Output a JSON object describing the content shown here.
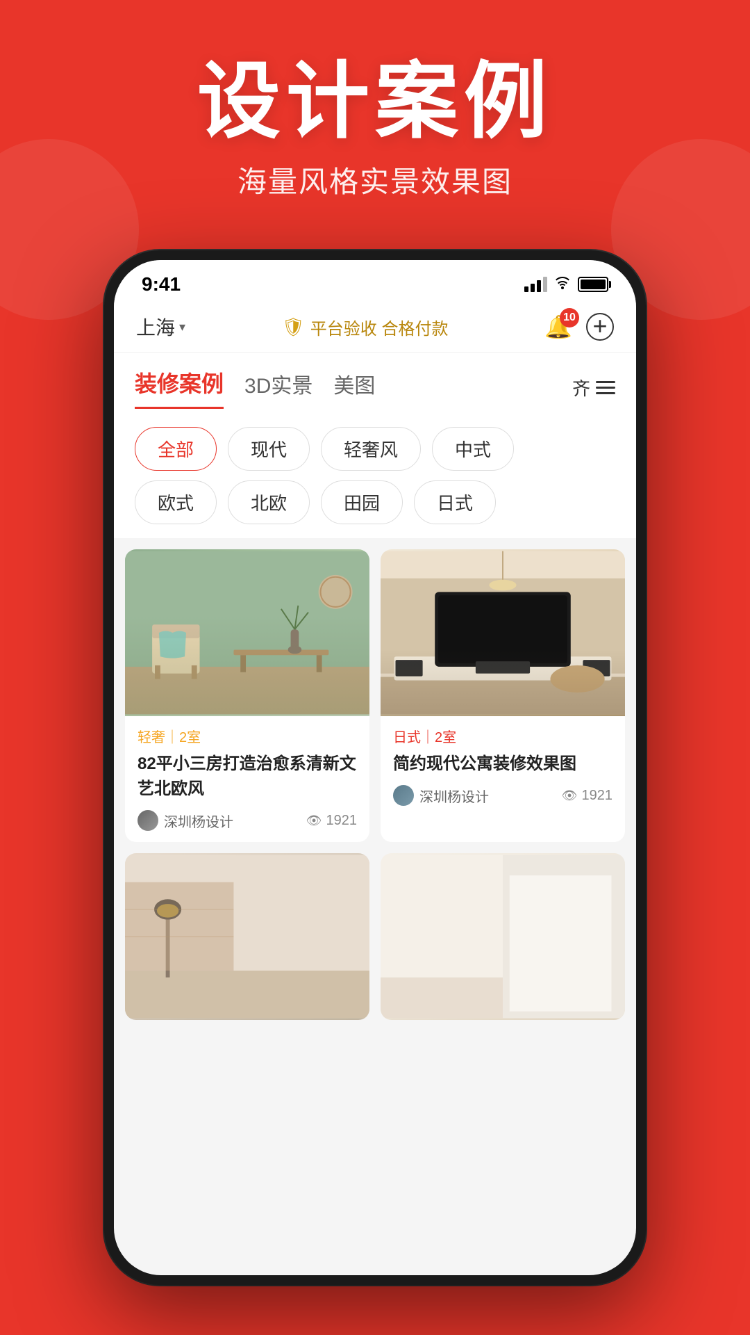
{
  "background": {
    "color": "#e8352a"
  },
  "hero": {
    "title": "设计案例",
    "subtitle": "海量风格实景效果图"
  },
  "statusBar": {
    "time": "9:41",
    "signal": "signal",
    "wifi": "wifi",
    "battery": "battery"
  },
  "topNav": {
    "city": "上海",
    "platform_text": "平台验收 合格付款",
    "notification_count": "10",
    "city_label": "上海 >"
  },
  "tabs": [
    {
      "id": "renovation",
      "label": "装修案例",
      "active": true
    },
    {
      "id": "3d",
      "label": "3D实景",
      "active": false
    },
    {
      "id": "beauty",
      "label": "美图",
      "active": false
    }
  ],
  "filters": {
    "row1": [
      {
        "id": "all",
        "label": "全部",
        "active": true
      },
      {
        "id": "modern",
        "label": "现代",
        "active": false
      },
      {
        "id": "luxury",
        "label": "轻奢风",
        "active": false
      },
      {
        "id": "chinese",
        "label": "中式",
        "active": false
      }
    ],
    "row2": [
      {
        "id": "european",
        "label": "欧式",
        "active": false
      },
      {
        "id": "nordic",
        "label": "北欧",
        "active": false
      },
      {
        "id": "garden",
        "label": "田园",
        "active": false
      },
      {
        "id": "japanese",
        "label": "日式",
        "active": false
      }
    ]
  },
  "cards": [
    {
      "id": "card1",
      "tag": "轻奢｜2室",
      "tag_color": "orange",
      "title": "82平小三房打造治愈系清新文艺北欧风",
      "author": "深圳杨设计",
      "views": "1921",
      "image_type": "sage"
    },
    {
      "id": "card2",
      "tag": "日式｜2室",
      "tag_color": "red",
      "title": "简约现代公寓装修效果图",
      "author": "深圳杨设计",
      "views": "1921",
      "image_type": "tv"
    },
    {
      "id": "card3",
      "tag": "",
      "title": "",
      "author": "",
      "views": "",
      "image_type": "bottom-left"
    },
    {
      "id": "card4",
      "tag": "",
      "title": "",
      "author": "",
      "views": "",
      "image_type": "bottom-right"
    }
  ],
  "icons": {
    "bell": "🔔",
    "add": "+",
    "eye": "👁",
    "shield": "🛡️"
  }
}
